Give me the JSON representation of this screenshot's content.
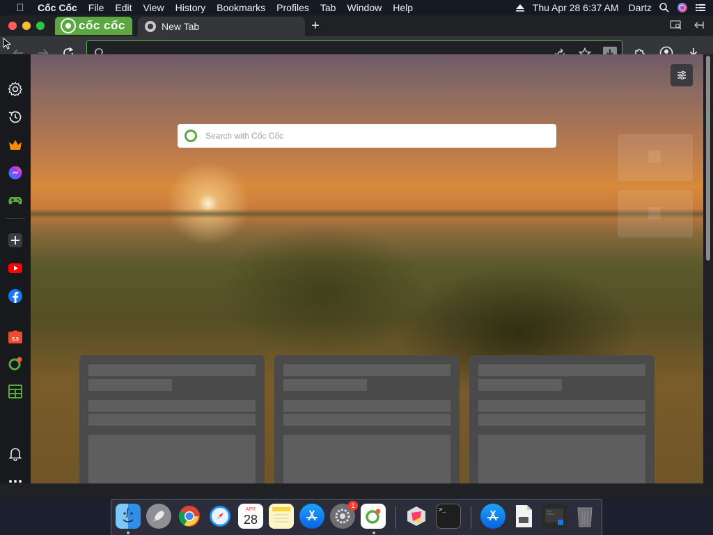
{
  "menubar": {
    "app_name": "Cốc Cốc",
    "menus": [
      "File",
      "Edit",
      "View",
      "History",
      "Bookmarks",
      "Profiles",
      "Tab",
      "Window",
      "Help"
    ],
    "clock": "Thu Apr 28  6:37 AM",
    "user": "Dartz"
  },
  "tabstrip": {
    "brand": "cốc cốc",
    "active_tab_title": "New Tab",
    "new_tab_label": "+"
  },
  "toolbar": {
    "address_value": "",
    "address_placeholder": ""
  },
  "sidebar": {
    "items": [
      "settings-icon",
      "history-icon",
      "crown-icon",
      "messenger-icon",
      "gamepad-icon",
      "add-icon",
      "youtube-icon",
      "facebook-icon",
      "shopee-icon",
      "coccoc-icon",
      "calculator-icon",
      "bell-icon",
      "more-icon"
    ]
  },
  "newtab": {
    "search_placeholder": "Search with Cốc Cốc"
  },
  "dock": {
    "calendar_month": "APR",
    "calendar_day": "28",
    "settings_badge": "1",
    "terminal_prompt": ">_"
  },
  "colors": {
    "brand_green": "#5aa83f",
    "omnibox_border": "#4caf50",
    "badge_red": "#ff3b30"
  }
}
